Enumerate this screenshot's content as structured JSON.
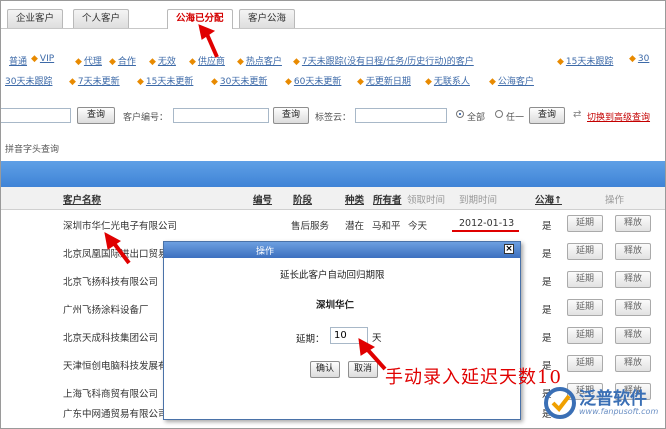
{
  "tabs": [
    "企业客户",
    "个人客户",
    "公海已分配",
    "客户公海"
  ],
  "active_tab": "公海已分配",
  "filters": {
    "row1": [
      "普通",
      "VIP",
      "代理",
      "合作",
      "无效",
      "供应商",
      "热点客户",
      "7天未跟踪(没有日程/任务/历史行动)的客户",
      "15天未跟踪",
      "30"
    ],
    "row2": [
      "30天未跟踪",
      "7天未更新",
      "15天未更新",
      "30天未更新",
      "60天未更新",
      "无更新日期",
      "无联系人",
      "公海客户"
    ]
  },
  "search": {
    "button_label": "查询",
    "customer_no_label": "客户编号：",
    "tag_cloud_label": "标签云：",
    "radio_all": "全部",
    "radio_any": "任一",
    "advanced_link": "切换到高级查询",
    "pinyin_label": "拼音字头查询"
  },
  "table": {
    "headers": {
      "name": "客户名称",
      "code": "编号",
      "stage": "阶段",
      "type": "种类",
      "owner": "所有者",
      "claim_time": "领取时间",
      "due_time": "到期时间",
      "public": "公海↑",
      "actions": "操作"
    },
    "rows": [
      {
        "name": "深圳市华仁光电子有限公司",
        "stage": "售后服务",
        "type": "潜在",
        "owner": "马和平",
        "claim_time": "今天",
        "due_time": "2012-01-13",
        "public": "是"
      },
      {
        "name": "北京凤凰国际进出口贸易",
        "public": "是"
      },
      {
        "name": "北京飞扬科技有限公司",
        "public": "是"
      },
      {
        "name": "广州飞扬涂料设备厂",
        "public": "是"
      },
      {
        "name": "北京天成科技集团公司",
        "public": "是"
      },
      {
        "name": "天津恒创电脑科技发展有限公司",
        "public": "是"
      },
      {
        "name": "上海飞科商贸有限公司",
        "public": "是"
      },
      {
        "name": "广东中网通贸易有限公司",
        "public": "是"
      }
    ],
    "extend_label": "延期",
    "release_label": "释放"
  },
  "dialog": {
    "title": "操作",
    "close": "×",
    "message": "延长此客户自动回归期限",
    "customer": "深圳华仁",
    "extend_label": "延期：",
    "extend_value": "10",
    "unit": "天",
    "confirm": "确认",
    "cancel": "取消"
  },
  "annotation": "手动录入延迟天数10",
  "brand": {
    "name": "泛普软件",
    "url": "www.fanpusoft.com"
  },
  "colors": {
    "accent_red": "#e00000",
    "header_blue": "#4a8ddd",
    "link_blue": "#3d6aa8",
    "filter_dot": "#e88a00"
  }
}
